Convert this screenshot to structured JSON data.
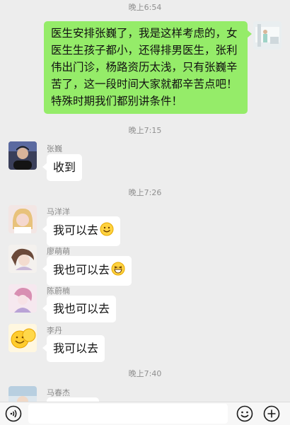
{
  "messages": {
    "top_time": "晚上6:54",
    "self_message": "医生安排张巍了，我是这样考虑的，女医生生孩子都小，还得排男医生，张利伟出门诊，杨路资历太浅，只有张巍辛苦了，这一段时间大家就都辛苦点吧！特殊时期我们都别讲条件！",
    "time_1": "晚上7:15",
    "m1": {
      "sender": "张巍",
      "text": "收到"
    },
    "time_2": "晚上7:26",
    "m2": {
      "sender": "马洋洋",
      "text": "我可以去",
      "emoji": "smile-emoji"
    },
    "m3": {
      "sender": "廖萌萌",
      "text": "我也可以去",
      "emoji": "grin-emoji"
    },
    "m4": {
      "sender": "陈蔚楠",
      "text": "我也可以去"
    },
    "m5": {
      "sender": "李丹",
      "text": "我可以去"
    },
    "time_3": "晚上7:40",
    "m6": {
      "sender": "马春杰",
      "text": ""
    }
  },
  "input_bar": {
    "voice_icon": "voice-icon",
    "emoji_icon": "emoji-icon",
    "plus_icon": "plus-icon"
  },
  "colors": {
    "background": "#ededed",
    "self_bubble": "#95ec69",
    "other_bubble": "#ffffff"
  }
}
